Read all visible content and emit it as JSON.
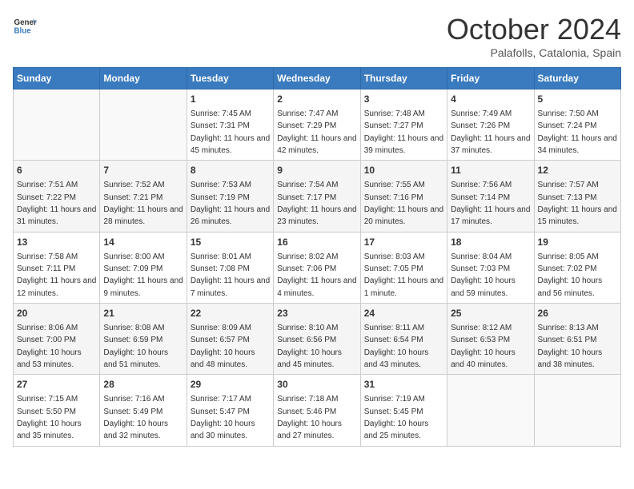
{
  "header": {
    "logo_line1": "General",
    "logo_line2": "Blue",
    "month": "October 2024",
    "location": "Palafolls, Catalonia, Spain"
  },
  "days_of_week": [
    "Sunday",
    "Monday",
    "Tuesday",
    "Wednesday",
    "Thursday",
    "Friday",
    "Saturday"
  ],
  "weeks": [
    [
      {
        "num": "",
        "sunrise": "",
        "sunset": "",
        "daylight": ""
      },
      {
        "num": "",
        "sunrise": "",
        "sunset": "",
        "daylight": ""
      },
      {
        "num": "1",
        "sunrise": "Sunrise: 7:45 AM",
        "sunset": "Sunset: 7:31 PM",
        "daylight": "Daylight: 11 hours and 45 minutes."
      },
      {
        "num": "2",
        "sunrise": "Sunrise: 7:47 AM",
        "sunset": "Sunset: 7:29 PM",
        "daylight": "Daylight: 11 hours and 42 minutes."
      },
      {
        "num": "3",
        "sunrise": "Sunrise: 7:48 AM",
        "sunset": "Sunset: 7:27 PM",
        "daylight": "Daylight: 11 hours and 39 minutes."
      },
      {
        "num": "4",
        "sunrise": "Sunrise: 7:49 AM",
        "sunset": "Sunset: 7:26 PM",
        "daylight": "Daylight: 11 hours and 37 minutes."
      },
      {
        "num": "5",
        "sunrise": "Sunrise: 7:50 AM",
        "sunset": "Sunset: 7:24 PM",
        "daylight": "Daylight: 11 hours and 34 minutes."
      }
    ],
    [
      {
        "num": "6",
        "sunrise": "Sunrise: 7:51 AM",
        "sunset": "Sunset: 7:22 PM",
        "daylight": "Daylight: 11 hours and 31 minutes."
      },
      {
        "num": "7",
        "sunrise": "Sunrise: 7:52 AM",
        "sunset": "Sunset: 7:21 PM",
        "daylight": "Daylight: 11 hours and 28 minutes."
      },
      {
        "num": "8",
        "sunrise": "Sunrise: 7:53 AM",
        "sunset": "Sunset: 7:19 PM",
        "daylight": "Daylight: 11 hours and 26 minutes."
      },
      {
        "num": "9",
        "sunrise": "Sunrise: 7:54 AM",
        "sunset": "Sunset: 7:17 PM",
        "daylight": "Daylight: 11 hours and 23 minutes."
      },
      {
        "num": "10",
        "sunrise": "Sunrise: 7:55 AM",
        "sunset": "Sunset: 7:16 PM",
        "daylight": "Daylight: 11 hours and 20 minutes."
      },
      {
        "num": "11",
        "sunrise": "Sunrise: 7:56 AM",
        "sunset": "Sunset: 7:14 PM",
        "daylight": "Daylight: 11 hours and 17 minutes."
      },
      {
        "num": "12",
        "sunrise": "Sunrise: 7:57 AM",
        "sunset": "Sunset: 7:13 PM",
        "daylight": "Daylight: 11 hours and 15 minutes."
      }
    ],
    [
      {
        "num": "13",
        "sunrise": "Sunrise: 7:58 AM",
        "sunset": "Sunset: 7:11 PM",
        "daylight": "Daylight: 11 hours and 12 minutes."
      },
      {
        "num": "14",
        "sunrise": "Sunrise: 8:00 AM",
        "sunset": "Sunset: 7:09 PM",
        "daylight": "Daylight: 11 hours and 9 minutes."
      },
      {
        "num": "15",
        "sunrise": "Sunrise: 8:01 AM",
        "sunset": "Sunset: 7:08 PM",
        "daylight": "Daylight: 11 hours and 7 minutes."
      },
      {
        "num": "16",
        "sunrise": "Sunrise: 8:02 AM",
        "sunset": "Sunset: 7:06 PM",
        "daylight": "Daylight: 11 hours and 4 minutes."
      },
      {
        "num": "17",
        "sunrise": "Sunrise: 8:03 AM",
        "sunset": "Sunset: 7:05 PM",
        "daylight": "Daylight: 11 hours and 1 minute."
      },
      {
        "num": "18",
        "sunrise": "Sunrise: 8:04 AM",
        "sunset": "Sunset: 7:03 PM",
        "daylight": "Daylight: 10 hours and 59 minutes."
      },
      {
        "num": "19",
        "sunrise": "Sunrise: 8:05 AM",
        "sunset": "Sunset: 7:02 PM",
        "daylight": "Daylight: 10 hours and 56 minutes."
      }
    ],
    [
      {
        "num": "20",
        "sunrise": "Sunrise: 8:06 AM",
        "sunset": "Sunset: 7:00 PM",
        "daylight": "Daylight: 10 hours and 53 minutes."
      },
      {
        "num": "21",
        "sunrise": "Sunrise: 8:08 AM",
        "sunset": "Sunset: 6:59 PM",
        "daylight": "Daylight: 10 hours and 51 minutes."
      },
      {
        "num": "22",
        "sunrise": "Sunrise: 8:09 AM",
        "sunset": "Sunset: 6:57 PM",
        "daylight": "Daylight: 10 hours and 48 minutes."
      },
      {
        "num": "23",
        "sunrise": "Sunrise: 8:10 AM",
        "sunset": "Sunset: 6:56 PM",
        "daylight": "Daylight: 10 hours and 45 minutes."
      },
      {
        "num": "24",
        "sunrise": "Sunrise: 8:11 AM",
        "sunset": "Sunset: 6:54 PM",
        "daylight": "Daylight: 10 hours and 43 minutes."
      },
      {
        "num": "25",
        "sunrise": "Sunrise: 8:12 AM",
        "sunset": "Sunset: 6:53 PM",
        "daylight": "Daylight: 10 hours and 40 minutes."
      },
      {
        "num": "26",
        "sunrise": "Sunrise: 8:13 AM",
        "sunset": "Sunset: 6:51 PM",
        "daylight": "Daylight: 10 hours and 38 minutes."
      }
    ],
    [
      {
        "num": "27",
        "sunrise": "Sunrise: 7:15 AM",
        "sunset": "Sunset: 5:50 PM",
        "daylight": "Daylight: 10 hours and 35 minutes."
      },
      {
        "num": "28",
        "sunrise": "Sunrise: 7:16 AM",
        "sunset": "Sunset: 5:49 PM",
        "daylight": "Daylight: 10 hours and 32 minutes."
      },
      {
        "num": "29",
        "sunrise": "Sunrise: 7:17 AM",
        "sunset": "Sunset: 5:47 PM",
        "daylight": "Daylight: 10 hours and 30 minutes."
      },
      {
        "num": "30",
        "sunrise": "Sunrise: 7:18 AM",
        "sunset": "Sunset: 5:46 PM",
        "daylight": "Daylight: 10 hours and 27 minutes."
      },
      {
        "num": "31",
        "sunrise": "Sunrise: 7:19 AM",
        "sunset": "Sunset: 5:45 PM",
        "daylight": "Daylight: 10 hours and 25 minutes."
      },
      {
        "num": "",
        "sunrise": "",
        "sunset": "",
        "daylight": ""
      },
      {
        "num": "",
        "sunrise": "",
        "sunset": "",
        "daylight": ""
      }
    ]
  ]
}
